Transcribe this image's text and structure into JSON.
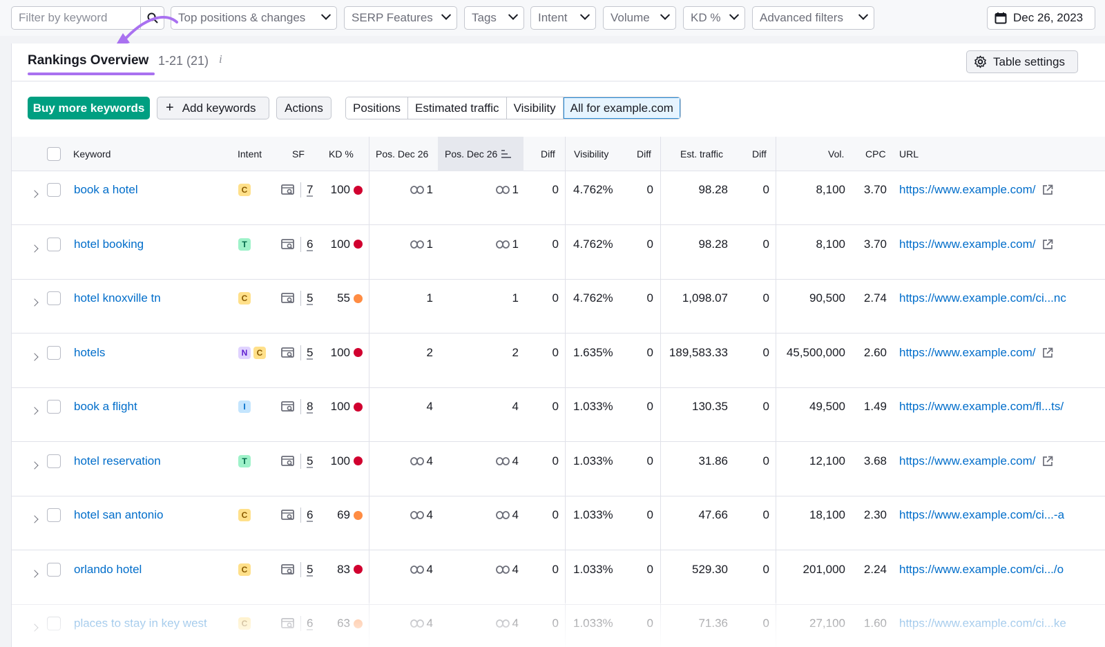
{
  "filters": {
    "search_placeholder": "Filter by keyword",
    "top_positions": "Top positions & changes",
    "serp_features": "SERP Features",
    "tags": "Tags",
    "intent": "Intent",
    "volume": "Volume",
    "kd": "KD %",
    "advanced": "Advanced filters",
    "date": "Dec 26, 2023"
  },
  "header": {
    "title": "Rankings Overview",
    "range": "1-21 (21)",
    "info": "i",
    "table_settings": "Table settings"
  },
  "actions": {
    "buy": "Buy more keywords",
    "add": "Add keywords",
    "actions": "Actions",
    "segments": [
      "Positions",
      "Estimated traffic",
      "Visibility",
      "All for example.com"
    ],
    "active_segment": "All for example.com"
  },
  "columns": {
    "keyword": "Keyword",
    "intent": "Intent",
    "sf": "SF",
    "kd": "KD %",
    "pos1": "Pos. Dec 26",
    "pos2": "Pos. Dec 26",
    "diff1": "Diff",
    "visibility": "Visibility",
    "diff2": "Diff",
    "traffic": "Est. traffic",
    "diff3": "Diff",
    "vol": "Vol.",
    "cpc": "CPC",
    "url": "URL"
  },
  "colors": {
    "accent_green": "#009f81",
    "link_blue": "#006dca",
    "highlight_purple": "#a971f0",
    "kd_red": "#d1002f",
    "kd_orange": "#ff8c43"
  },
  "rows": [
    {
      "keyword": "book a hotel",
      "intent": [
        "C"
      ],
      "sf": "7",
      "kd": "100",
      "kd_color": "red",
      "pos1": "1",
      "pos1_link": true,
      "pos2": "1",
      "pos2_link": true,
      "diff1": "0",
      "visibility": "4.762%",
      "diff2": "0",
      "traffic": "98.28",
      "diff3": "0",
      "vol": "8,100",
      "cpc": "3.70",
      "url": "https://www.example.com/",
      "url_ext": true
    },
    {
      "keyword": "hotel booking",
      "intent": [
        "T"
      ],
      "sf": "6",
      "kd": "100",
      "kd_color": "red",
      "pos1": "1",
      "pos1_link": true,
      "pos2": "1",
      "pos2_link": true,
      "diff1": "0",
      "visibility": "4.762%",
      "diff2": "0",
      "traffic": "98.28",
      "diff3": "0",
      "vol": "8,100",
      "cpc": "3.70",
      "url": "https://www.example.com/",
      "url_ext": true
    },
    {
      "keyword": "hotel knoxville tn",
      "intent": [
        "C"
      ],
      "sf": "5",
      "kd": "55",
      "kd_color": "orange",
      "pos1": "1",
      "pos1_link": false,
      "pos2": "1",
      "pos2_link": false,
      "diff1": "0",
      "visibility": "4.762%",
      "diff2": "0",
      "traffic": "1,098.07",
      "diff3": "0",
      "vol": "90,500",
      "cpc": "2.74",
      "url": "https://www.example.com/ci...nc",
      "url_ext": false
    },
    {
      "keyword": "hotels",
      "intent": [
        "N",
        "C"
      ],
      "sf": "5",
      "kd": "100",
      "kd_color": "red",
      "pos1": "2",
      "pos1_link": false,
      "pos2": "2",
      "pos2_link": false,
      "diff1": "0",
      "visibility": "1.635%",
      "diff2": "0",
      "traffic": "189,583.33",
      "diff3": "0",
      "vol": "45,500,000",
      "cpc": "2.60",
      "url": "https://www.example.com/",
      "url_ext": true
    },
    {
      "keyword": "book a flight",
      "intent": [
        "I"
      ],
      "sf": "8",
      "kd": "100",
      "kd_color": "red",
      "pos1": "4",
      "pos1_link": false,
      "pos2": "4",
      "pos2_link": false,
      "diff1": "0",
      "visibility": "1.033%",
      "diff2": "0",
      "traffic": "130.35",
      "diff3": "0",
      "vol": "49,500",
      "cpc": "1.49",
      "url": "https://www.example.com/fl...ts/",
      "url_ext": false
    },
    {
      "keyword": "hotel reservation",
      "intent": [
        "T"
      ],
      "sf": "5",
      "kd": "100",
      "kd_color": "red",
      "pos1": "4",
      "pos1_link": true,
      "pos2": "4",
      "pos2_link": true,
      "diff1": "0",
      "visibility": "1.033%",
      "diff2": "0",
      "traffic": "31.86",
      "diff3": "0",
      "vol": "12,100",
      "cpc": "3.68",
      "url": "https://www.example.com/",
      "url_ext": true
    },
    {
      "keyword": "hotel san antonio",
      "intent": [
        "C"
      ],
      "sf": "6",
      "kd": "69",
      "kd_color": "orange",
      "pos1": "4",
      "pos1_link": true,
      "pos2": "4",
      "pos2_link": true,
      "diff1": "0",
      "visibility": "1.033%",
      "diff2": "0",
      "traffic": "47.66",
      "diff3": "0",
      "vol": "18,100",
      "cpc": "2.30",
      "url": "https://www.example.com/ci...-a",
      "url_ext": false
    },
    {
      "keyword": "orlando hotel",
      "intent": [
        "C"
      ],
      "sf": "5",
      "kd": "83",
      "kd_color": "red",
      "pos1": "4",
      "pos1_link": true,
      "pos2": "4",
      "pos2_link": true,
      "diff1": "0",
      "visibility": "1.033%",
      "diff2": "0",
      "traffic": "529.30",
      "diff3": "0",
      "vol": "201,000",
      "cpc": "2.24",
      "url": "https://www.example.com/ci.../o",
      "url_ext": false
    },
    {
      "keyword": "places to stay in key west",
      "intent": [
        "C"
      ],
      "sf": "6",
      "kd": "63",
      "kd_color": "orange",
      "pos1": "4",
      "pos1_link": true,
      "pos2": "4",
      "pos2_link": true,
      "diff1": "0",
      "visibility": "1.033%",
      "diff2": "0",
      "traffic": "71.36",
      "diff3": "0",
      "vol": "27,100",
      "cpc": "1.60",
      "url": "https://www.example.com/ci...ke",
      "url_ext": false
    }
  ]
}
